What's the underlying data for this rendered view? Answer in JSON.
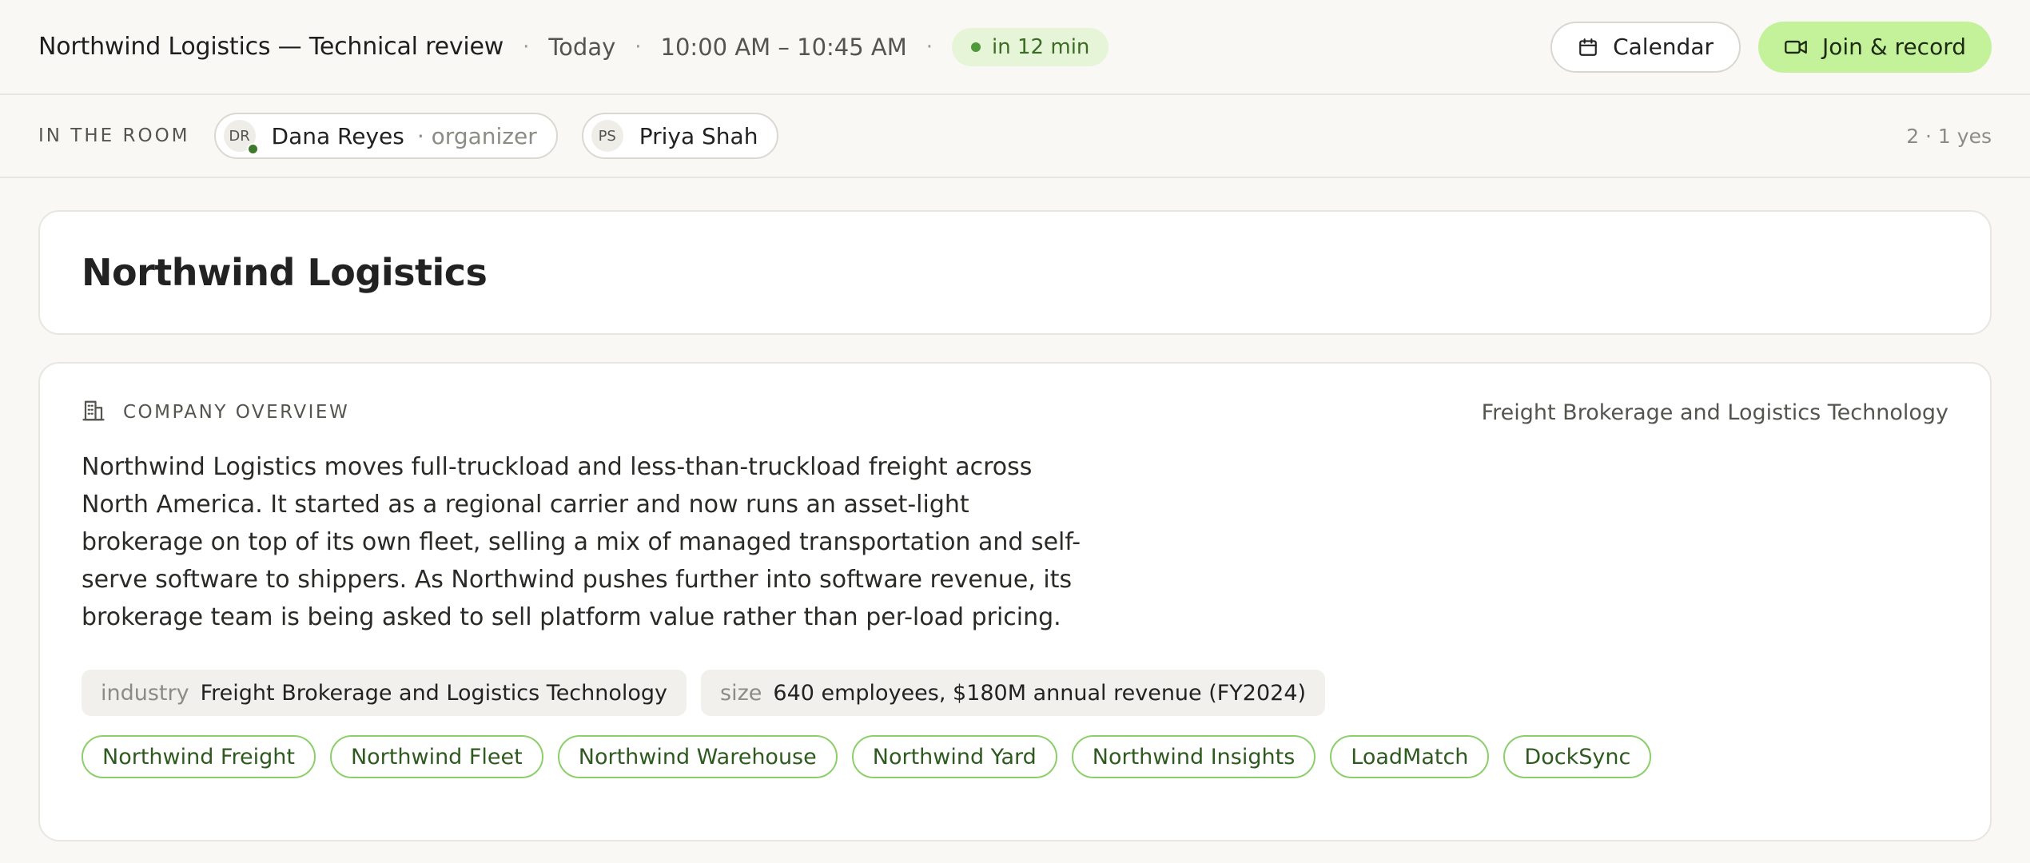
{
  "header": {
    "title": "Northwind Logistics — Technical review",
    "separator": "·",
    "day": "Today",
    "time_range": "10:00 AM – 10:45 AM",
    "status": "in 12 min",
    "calendar_label": "Calendar",
    "join_label": "Join & record"
  },
  "room": {
    "label": "IN THE ROOM",
    "participants": [
      {
        "initials": "DR",
        "name": "Dana Reyes",
        "role": "· organizer",
        "online": true
      },
      {
        "initials": "PS",
        "name": "Priya Shah",
        "role": "",
        "online": false
      }
    ],
    "count": "2 · 1 yes"
  },
  "company": {
    "name": "Northwind Logistics",
    "section_label": "COMPANY OVERVIEW",
    "category": "Freight Brokerage and Logistics Technology",
    "description": "Northwind Logistics moves full-truckload and less-than-truckload freight across North America. It started as a regional carrier and now runs an asset-light brokerage on top of its own fleet, selling a mix of managed transportation and self-serve software to shippers. As Northwind pushes further into software revenue, its brokerage team is being asked to sell platform value rather than per-load pricing.",
    "facts": [
      {
        "key": "industry",
        "value": "Freight Brokerage and Logistics Technology"
      },
      {
        "key": "size",
        "value": "640 employees, $180M annual revenue (FY2024)"
      }
    ],
    "products": [
      "Northwind Freight",
      "Northwind Fleet",
      "Northwind Warehouse",
      "Northwind Yard",
      "Northwind Insights",
      "LoadMatch",
      "DockSync"
    ]
  },
  "colors": {
    "accent": "#c4f29a",
    "status_bg": "#e6f5d8",
    "online": "#3e7a2c",
    "product_border": "#8ccf6a"
  },
  "icons": {
    "calendar": "calendar-icon",
    "join": "video-camera-icon",
    "overview": "building-icon"
  }
}
